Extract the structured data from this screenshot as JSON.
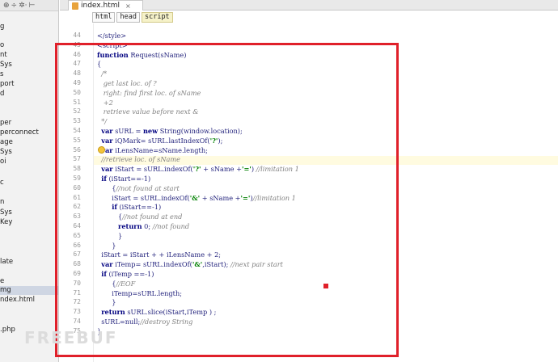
{
  "sidebar": {
    "toolbar_icons": [
      "globe-icon",
      "split-icon",
      "gear-icon",
      "collapse-icon"
    ],
    "toolbar_glyphs": [
      "⊕",
      "÷",
      "✲·",
      "⊢"
    ],
    "items": [
      {
        "label": "g",
        "selected": false
      },
      {
        "label": "o",
        "selected": false
      },
      {
        "label": "nt",
        "selected": false
      },
      {
        "label": "Sys",
        "selected": false
      },
      {
        "label": "s",
        "selected": false
      },
      {
        "label": "port",
        "selected": false
      },
      {
        "label": "d",
        "selected": false
      },
      {
        "label": "per",
        "selected": false
      },
      {
        "label": "perconnect",
        "selected": false
      },
      {
        "label": "age",
        "selected": false
      },
      {
        "label": "Sys",
        "selected": false
      },
      {
        "label": "oi",
        "selected": false
      },
      {
        "label": "c",
        "selected": false
      },
      {
        "label": "n",
        "selected": false
      },
      {
        "label": "Sys",
        "selected": false
      },
      {
        "label": "Key",
        "selected": false
      },
      {
        "label": "late",
        "selected": false
      },
      {
        "label": "e",
        "selected": false
      },
      {
        "label": "mg",
        "selected": true
      },
      {
        "label": "ndex.html",
        "selected": false
      },
      {
        "label": ".php",
        "selected": false
      }
    ]
  },
  "tabs": [
    {
      "label": "index.html",
      "icon": "html-file-icon",
      "close": "×"
    }
  ],
  "breadcrumb": [
    "html",
    "head",
    "script"
  ],
  "code_lines": [
    {
      "no": "44",
      "text": "</style>"
    },
    {
      "no": "45",
      "text": "<script>"
    },
    {
      "no": "46",
      "text": "function Request(sName)"
    },
    {
      "no": "47",
      "text": "{"
    },
    {
      "no": "48",
      "text": "  /*"
    },
    {
      "no": "49",
      "text": "   get last loc. of ?"
    },
    {
      "no": "50",
      "text": "   right: find first loc. of sName"
    },
    {
      "no": "51",
      "text": "   +2"
    },
    {
      "no": "52",
      "text": "   retrieve value before next &"
    },
    {
      "no": "53",
      "text": "  */"
    },
    {
      "no": "54",
      "text": "  var sURL = new String(window.location);"
    },
    {
      "no": "55",
      "text": "  var iQMark= sURL.lastIndexOf('?');"
    },
    {
      "no": "56",
      "text": "  var iLensName=sName.length;"
    },
    {
      "no": "57",
      "text": "  //retrieve loc. of sName"
    },
    {
      "no": "58",
      "text": "  var iStart = sURL.indexOf('?' + sName +'=') //limitation 1"
    },
    {
      "no": "59",
      "text": "  if (iStart==-1)"
    },
    {
      "no": "60",
      "text": "       {//not found at start"
    },
    {
      "no": "61",
      "text": "       iStart = sURL.indexOf('&' + sName +'=')//limitation 1"
    },
    {
      "no": "62",
      "text": "       if (iStart==-1)"
    },
    {
      "no": "63",
      "text": "          {//not found at end"
    },
    {
      "no": "64",
      "text": "          return 0; //not found"
    },
    {
      "no": "65",
      "text": "          }"
    },
    {
      "no": "66",
      "text": "       }"
    },
    {
      "no": "67",
      "text": "  iStart = iStart + + iLensName + 2;"
    },
    {
      "no": "68",
      "text": "  var iTemp= sURL.indexOf('&',iStart); //next pair start"
    },
    {
      "no": "69",
      "text": "  if (iTemp ==-1)"
    },
    {
      "no": "70",
      "text": "       {//EOF"
    },
    {
      "no": "71",
      "text": "       iTemp=sURL.length;"
    },
    {
      "no": "72",
      "text": "       }"
    },
    {
      "no": "73",
      "text": "  return sURL.slice(iStart,iTemp ) ;"
    },
    {
      "no": "74",
      "text": "  sURL=null;//destroy String"
    },
    {
      "no": "75",
      "text": "}"
    }
  ],
  "watermark": "FREEBUF",
  "colors": {
    "annotation": "#e0202a",
    "keyword": "#000080",
    "comment": "#808080",
    "string": "#008000"
  }
}
